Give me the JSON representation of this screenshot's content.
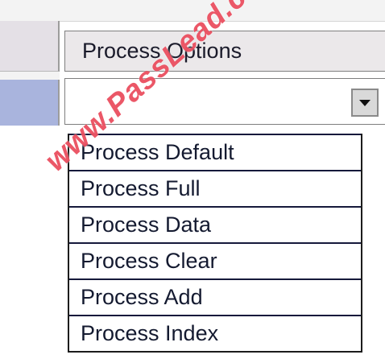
{
  "grid": {
    "column_header": "Process Options",
    "selected_value": ""
  },
  "dropdown": {
    "options": [
      "Process Default",
      "Process Full",
      "Process Data",
      "Process Clear",
      "Process Add",
      "Process Index"
    ]
  },
  "watermark": {
    "text": "www.PassLead.com"
  },
  "icons": {
    "dropdown_toggle": "chevron-down-icon"
  },
  "colors": {
    "row_selector": "#a9b4dd",
    "header_bg": "#ebe8ea",
    "list_border": "#15193b",
    "watermark": "#e6283c"
  }
}
